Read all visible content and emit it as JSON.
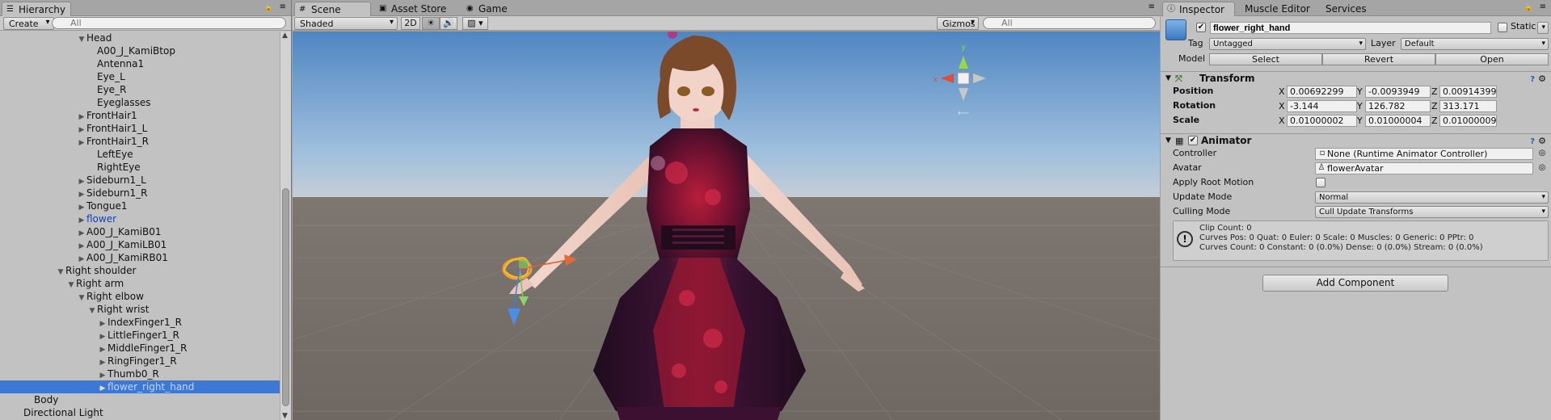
{
  "hierarchy": {
    "tab": "Hierarchy",
    "create_label": "Create",
    "search_placeholder": "All",
    "items": [
      {
        "label": "Head",
        "indent": 7,
        "arrow": "▼",
        "prefab": false,
        "selected": false
      },
      {
        "label": "A00_J_KamiBtop",
        "indent": 8,
        "arrow": "",
        "prefab": false,
        "selected": false
      },
      {
        "label": "Antenna1",
        "indent": 8,
        "arrow": "",
        "prefab": false,
        "selected": false
      },
      {
        "label": "Eye_L",
        "indent": 8,
        "arrow": "",
        "prefab": false,
        "selected": false
      },
      {
        "label": "Eye_R",
        "indent": 8,
        "arrow": "",
        "prefab": false,
        "selected": false
      },
      {
        "label": "Eyeglasses",
        "indent": 8,
        "arrow": "",
        "prefab": false,
        "selected": false
      },
      {
        "label": "FrontHair1",
        "indent": 7,
        "arrow": "▶",
        "prefab": false,
        "selected": false
      },
      {
        "label": "FrontHair1_L",
        "indent": 7,
        "arrow": "▶",
        "prefab": false,
        "selected": false
      },
      {
        "label": "FrontHair1_R",
        "indent": 7,
        "arrow": "▶",
        "prefab": false,
        "selected": false
      },
      {
        "label": "LeftEye",
        "indent": 8,
        "arrow": "",
        "prefab": false,
        "selected": false
      },
      {
        "label": "RightEye",
        "indent": 8,
        "arrow": "",
        "prefab": false,
        "selected": false
      },
      {
        "label": "Sideburn1_L",
        "indent": 7,
        "arrow": "▶",
        "prefab": false,
        "selected": false
      },
      {
        "label": "Sideburn1_R",
        "indent": 7,
        "arrow": "▶",
        "prefab": false,
        "selected": false
      },
      {
        "label": "Tongue1",
        "indent": 7,
        "arrow": "▶",
        "prefab": false,
        "selected": false
      },
      {
        "label": "flower",
        "indent": 7,
        "arrow": "▶",
        "prefab": true,
        "selected": false
      },
      {
        "label": "A00_J_KamiB01",
        "indent": 7,
        "arrow": "▶",
        "prefab": false,
        "selected": false
      },
      {
        "label": "A00_J_KamiLB01",
        "indent": 7,
        "arrow": "▶",
        "prefab": false,
        "selected": false
      },
      {
        "label": "A00_J_KamiRB01",
        "indent": 7,
        "arrow": "▶",
        "prefab": false,
        "selected": false
      },
      {
        "label": "Right shoulder",
        "indent": 5,
        "arrow": "▼",
        "prefab": false,
        "selected": false
      },
      {
        "label": "Right arm",
        "indent": 6,
        "arrow": "▼",
        "prefab": false,
        "selected": false
      },
      {
        "label": "Right elbow",
        "indent": 7,
        "arrow": "▼",
        "prefab": false,
        "selected": false
      },
      {
        "label": "Right wrist",
        "indent": 8,
        "arrow": "▼",
        "prefab": false,
        "selected": false
      },
      {
        "label": "IndexFinger1_R",
        "indent": 9,
        "arrow": "▶",
        "prefab": false,
        "selected": false
      },
      {
        "label": "LittleFinger1_R",
        "indent": 9,
        "arrow": "▶",
        "prefab": false,
        "selected": false
      },
      {
        "label": "MiddleFinger1_R",
        "indent": 9,
        "arrow": "▶",
        "prefab": false,
        "selected": false
      },
      {
        "label": "RingFinger1_R",
        "indent": 9,
        "arrow": "▶",
        "prefab": false,
        "selected": false
      },
      {
        "label": "Thumb0_R",
        "indent": 9,
        "arrow": "▶",
        "prefab": false,
        "selected": false
      },
      {
        "label": "flower_right_hand",
        "indent": 9,
        "arrow": "▶",
        "prefab": true,
        "selected": true
      },
      {
        "label": "Body",
        "indent": 2,
        "arrow": "",
        "prefab": false,
        "selected": false
      },
      {
        "label": "Directional Light",
        "indent": 1,
        "arrow": "",
        "prefab": false,
        "selected": false
      }
    ]
  },
  "scene": {
    "tabs": [
      "Scene",
      "Asset Store",
      "Game"
    ],
    "shading_mode": "Shaded",
    "mode_2d": "2D",
    "gizmos_label": "Gizmos",
    "search_placeholder": "All",
    "gizmo_axis_y": "y",
    "gizmo_axis_x": "x"
  },
  "inspector": {
    "tabs": [
      "Inspector",
      "Muscle Editor",
      "Services"
    ],
    "object_name": "flower_right_hand",
    "static_label": "Static",
    "tag_label": "Tag",
    "tag_value": "Untagged",
    "layer_label": "Layer",
    "layer_value": "Default",
    "model_label": "Model",
    "model_buttons": [
      "Select",
      "Revert",
      "Open"
    ],
    "transform": {
      "title": "Transform",
      "rows": [
        {
          "label": "Position",
          "x": "0.00692299",
          "y": "-0.0093949",
          "z": "0.00914399"
        },
        {
          "label": "Rotation",
          "x": "-3.144",
          "y": "126.782",
          "z": "313.171"
        },
        {
          "label": "Scale",
          "x": "0.01000002",
          "y": "0.01000004",
          "z": "0.01000009"
        }
      ]
    },
    "animator": {
      "title": "Animator",
      "controller_label": "Controller",
      "controller_value": "None (Runtime Animator Controller)",
      "avatar_label": "Avatar",
      "avatar_value": "flowerAvatar",
      "apply_root_motion_label": "Apply Root Motion",
      "update_mode_label": "Update Mode",
      "update_mode_value": "Normal",
      "culling_mode_label": "Culling Mode",
      "culling_mode_value": "Cull Update Transforms",
      "info_line1": "Clip Count: 0",
      "info_line2": "Curves Pos: 0 Quat: 0 Euler: 0 Scale: 0 Muscles: 0 Generic: 0 PPtr: 0",
      "info_line3": "Curves Count: 0 Constant: 0 (0.0%) Dense: 0 (0.0%) Stream: 0 (0.0%)"
    },
    "add_component_label": "Add Component"
  },
  "colors": {
    "selection": "#3d78d6",
    "prefab_text": "#1e3ea8",
    "panel_bg": "#c2c2c2"
  }
}
